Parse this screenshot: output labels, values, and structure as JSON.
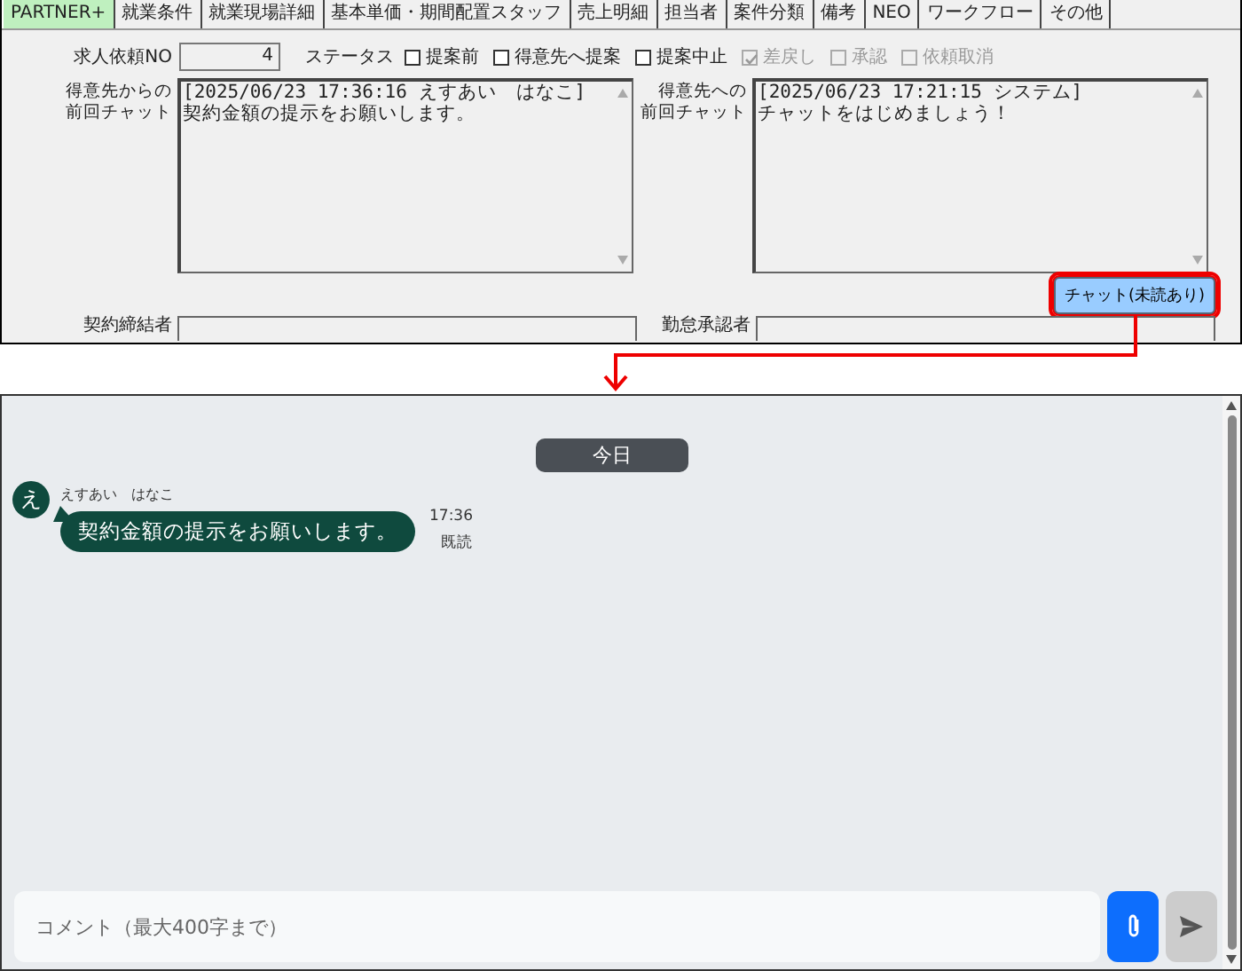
{
  "tabs": [
    {
      "label": "PARTNER+",
      "selected": true
    },
    {
      "label": "就業条件",
      "selected": false
    },
    {
      "label": "就業現場詳細",
      "selected": false
    },
    {
      "label": "基本単価・期間配置スタッフ",
      "selected": false
    },
    {
      "label": "売上明細",
      "selected": false
    },
    {
      "label": "担当者",
      "selected": false
    },
    {
      "label": "案件分類",
      "selected": false
    },
    {
      "label": "備考",
      "selected": false
    },
    {
      "label": "NEO",
      "selected": false
    },
    {
      "label": "ワークフロー",
      "selected": false
    },
    {
      "label": "その他",
      "selected": false
    }
  ],
  "request_no": {
    "label": "求人依頼NO",
    "value": "4"
  },
  "status": {
    "label": "ステータス",
    "options": [
      {
        "label": "提案前",
        "checked": false,
        "disabled": false
      },
      {
        "label": "得意先へ提案",
        "checked": false,
        "disabled": false
      },
      {
        "label": "提案中止",
        "checked": false,
        "disabled": false
      },
      {
        "label": "差戻し",
        "checked": true,
        "disabled": true
      },
      {
        "label": "承認",
        "checked": false,
        "disabled": true
      },
      {
        "label": "依頼取消",
        "checked": false,
        "disabled": true
      }
    ]
  },
  "chat_panels": [
    {
      "label_lines": [
        "得意先からの",
        "前回チャット"
      ],
      "lines": [
        "[2025/06/23 17:36:16 えすあい　はなこ]",
        "契約金額の提示をお願いします。"
      ]
    },
    {
      "label_lines": [
        "得意先への",
        "前回チャット"
      ],
      "lines": [
        "[2025/06/23 17:21:15 システム]",
        "チャットをはじめましょう！"
      ]
    }
  ],
  "chat_button": {
    "label": "チャット(未読あり)"
  },
  "bottom_fields": [
    {
      "label": "契約締結者"
    },
    {
      "label": "勤怠承認者"
    }
  ],
  "chat": {
    "date_divider": "今日",
    "messages": [
      {
        "avatar": "え",
        "sender": "えすあい　はなこ",
        "text": "契約金額の提示をお願いします。",
        "time": "17:36",
        "read_status": "既読"
      }
    ],
    "comment": {
      "placeholder": "コメント（最大400字まで）"
    }
  }
}
